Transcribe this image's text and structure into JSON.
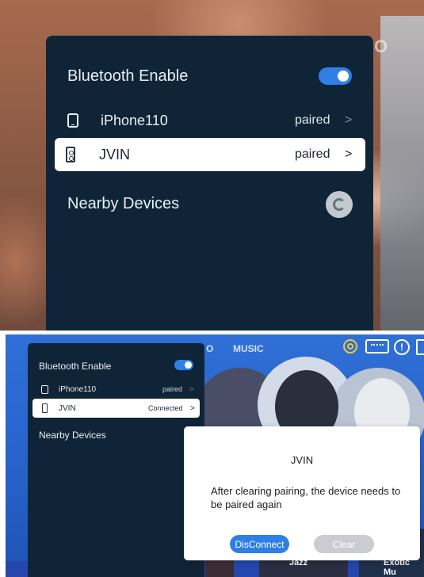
{
  "top": {
    "bluetooth_label": "Bluetooth Enable",
    "bluetooth_enabled": true,
    "devices": [
      {
        "name": "iPhone110",
        "status": "paired",
        "chevron": ">",
        "icon": "phone-icon"
      },
      {
        "name": "JVIN",
        "status": "paired",
        "chevron": ">",
        "icon": "speaker-icon",
        "selected": true
      }
    ],
    "nearby_label": "Nearby Devices",
    "bg_partial_text": "O"
  },
  "bottom": {
    "nav": {
      "partial": "O",
      "music": "MUSIC",
      "info": "!"
    },
    "bluetooth_label": "Bluetooth Enable",
    "bluetooth_enabled": true,
    "devices": [
      {
        "name": "iPhone110",
        "status": "paired",
        "chevron": ">",
        "icon": "phone-icon"
      },
      {
        "name": "JVIN",
        "status": "Connected",
        "chevron": ">",
        "icon": "speaker-icon",
        "selected": true
      }
    ],
    "nearby_label": "Nearby Devices",
    "tiles": {
      "jazz": "Jazz",
      "exotic": "Exotic Mu"
    },
    "dialog": {
      "title": "JVIN",
      "message": "After clearing pairing, the device needs to be paired again",
      "disconnect_label": "DisConnect",
      "clear_label": "Clear"
    }
  },
  "colors": {
    "panel": "#0f2537",
    "accent": "#2f7fe6",
    "text_light": "#e9eef3",
    "disabled_button": "#c9cdd1"
  }
}
